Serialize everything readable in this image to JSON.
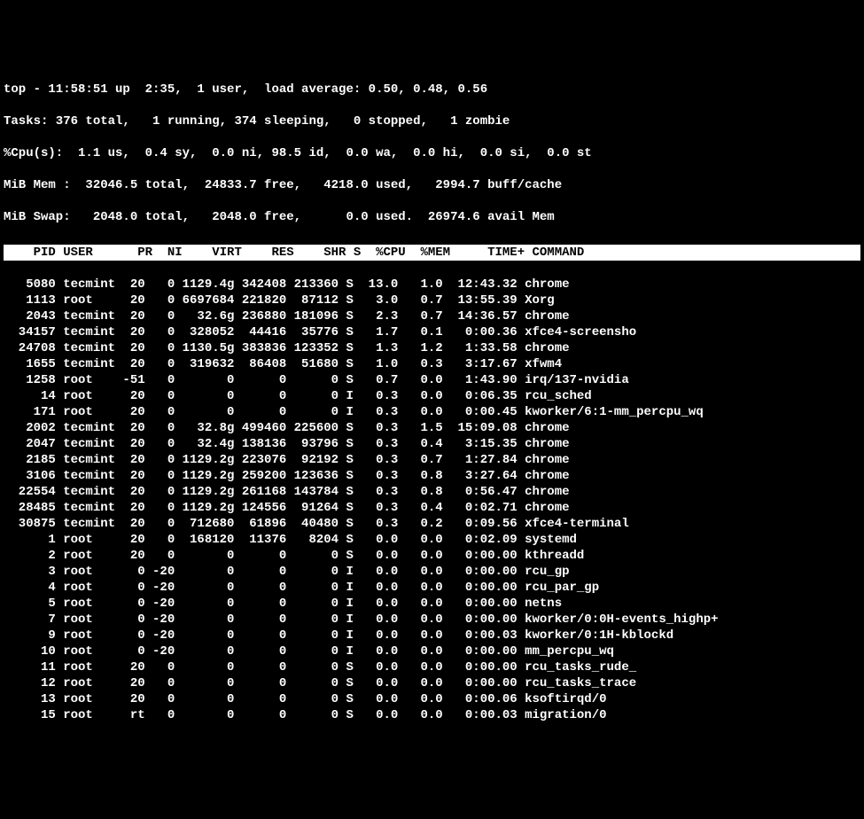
{
  "header": {
    "line1": "top - 11:58:51 up  2:35,  1 user,  load average: 0.50, 0.48, 0.56",
    "line2": "Tasks: 376 total,   1 running, 374 sleeping,   0 stopped,   1 zombie",
    "line3": "%Cpu(s):  1.1 us,  0.4 sy,  0.0 ni, 98.5 id,  0.0 wa,  0.0 hi,  0.0 si,  0.0 st",
    "line4": "MiB Mem :  32046.5 total,  24833.7 free,   4218.0 used,   2994.7 buff/cache",
    "line5": "MiB Swap:   2048.0 total,   2048.0 free,      0.0 used.  26974.6 avail Mem"
  },
  "columns": {
    "header_line": "    PID USER      PR  NI    VIRT    RES    SHR S  %CPU  %MEM     TIME+ COMMAND                          "
  },
  "processes": [
    {
      "pid": "5080",
      "user": "tecmint",
      "pr": "20",
      "ni": "0",
      "virt": "1129.4g",
      "res": "342408",
      "shr": "213360",
      "s": "S",
      "cpu": "13.0",
      "mem": "1.0",
      "time": "12:43.32",
      "cmd": "chrome"
    },
    {
      "pid": "1113",
      "user": "root",
      "pr": "20",
      "ni": "0",
      "virt": "6697684",
      "res": "221820",
      "shr": "87112",
      "s": "S",
      "cpu": "3.0",
      "mem": "0.7",
      "time": "13:55.39",
      "cmd": "Xorg"
    },
    {
      "pid": "2043",
      "user": "tecmint",
      "pr": "20",
      "ni": "0",
      "virt": "32.6g",
      "res": "236880",
      "shr": "181096",
      "s": "S",
      "cpu": "2.3",
      "mem": "0.7",
      "time": "14:36.57",
      "cmd": "chrome"
    },
    {
      "pid": "34157",
      "user": "tecmint",
      "pr": "20",
      "ni": "0",
      "virt": "328052",
      "res": "44416",
      "shr": "35776",
      "s": "S",
      "cpu": "1.7",
      "mem": "0.1",
      "time": "0:00.36",
      "cmd": "xfce4-screensho"
    },
    {
      "pid": "24708",
      "user": "tecmint",
      "pr": "20",
      "ni": "0",
      "virt": "1130.5g",
      "res": "383836",
      "shr": "123352",
      "s": "S",
      "cpu": "1.3",
      "mem": "1.2",
      "time": "1:33.58",
      "cmd": "chrome"
    },
    {
      "pid": "1655",
      "user": "tecmint",
      "pr": "20",
      "ni": "0",
      "virt": "319632",
      "res": "86408",
      "shr": "51680",
      "s": "S",
      "cpu": "1.0",
      "mem": "0.3",
      "time": "3:17.67",
      "cmd": "xfwm4"
    },
    {
      "pid": "1258",
      "user": "root",
      "pr": "-51",
      "ni": "0",
      "virt": "0",
      "res": "0",
      "shr": "0",
      "s": "S",
      "cpu": "0.7",
      "mem": "0.0",
      "time": "1:43.90",
      "cmd": "irq/137-nvidia"
    },
    {
      "pid": "14",
      "user": "root",
      "pr": "20",
      "ni": "0",
      "virt": "0",
      "res": "0",
      "shr": "0",
      "s": "I",
      "cpu": "0.3",
      "mem": "0.0",
      "time": "0:06.35",
      "cmd": "rcu_sched"
    },
    {
      "pid": "171",
      "user": "root",
      "pr": "20",
      "ni": "0",
      "virt": "0",
      "res": "0",
      "shr": "0",
      "s": "I",
      "cpu": "0.3",
      "mem": "0.0",
      "time": "0:00.45",
      "cmd": "kworker/6:1-mm_percpu_wq"
    },
    {
      "pid": "2002",
      "user": "tecmint",
      "pr": "20",
      "ni": "0",
      "virt": "32.8g",
      "res": "499460",
      "shr": "225600",
      "s": "S",
      "cpu": "0.3",
      "mem": "1.5",
      "time": "15:09.08",
      "cmd": "chrome"
    },
    {
      "pid": "2047",
      "user": "tecmint",
      "pr": "20",
      "ni": "0",
      "virt": "32.4g",
      "res": "138136",
      "shr": "93796",
      "s": "S",
      "cpu": "0.3",
      "mem": "0.4",
      "time": "3:15.35",
      "cmd": "chrome"
    },
    {
      "pid": "2185",
      "user": "tecmint",
      "pr": "20",
      "ni": "0",
      "virt": "1129.2g",
      "res": "223076",
      "shr": "92192",
      "s": "S",
      "cpu": "0.3",
      "mem": "0.7",
      "time": "1:27.84",
      "cmd": "chrome"
    },
    {
      "pid": "3106",
      "user": "tecmint",
      "pr": "20",
      "ni": "0",
      "virt": "1129.2g",
      "res": "259200",
      "shr": "123636",
      "s": "S",
      "cpu": "0.3",
      "mem": "0.8",
      "time": "3:27.64",
      "cmd": "chrome"
    },
    {
      "pid": "22554",
      "user": "tecmint",
      "pr": "20",
      "ni": "0",
      "virt": "1129.2g",
      "res": "261168",
      "shr": "143784",
      "s": "S",
      "cpu": "0.3",
      "mem": "0.8",
      "time": "0:56.47",
      "cmd": "chrome"
    },
    {
      "pid": "28485",
      "user": "tecmint",
      "pr": "20",
      "ni": "0",
      "virt": "1129.2g",
      "res": "124556",
      "shr": "91264",
      "s": "S",
      "cpu": "0.3",
      "mem": "0.4",
      "time": "0:02.71",
      "cmd": "chrome"
    },
    {
      "pid": "30875",
      "user": "tecmint",
      "pr": "20",
      "ni": "0",
      "virt": "712680",
      "res": "61896",
      "shr": "40480",
      "s": "S",
      "cpu": "0.3",
      "mem": "0.2",
      "time": "0:09.56",
      "cmd": "xfce4-terminal"
    },
    {
      "pid": "1",
      "user": "root",
      "pr": "20",
      "ni": "0",
      "virt": "168120",
      "res": "11376",
      "shr": "8204",
      "s": "S",
      "cpu": "0.0",
      "mem": "0.0",
      "time": "0:02.09",
      "cmd": "systemd"
    },
    {
      "pid": "2",
      "user": "root",
      "pr": "20",
      "ni": "0",
      "virt": "0",
      "res": "0",
      "shr": "0",
      "s": "S",
      "cpu": "0.0",
      "mem": "0.0",
      "time": "0:00.00",
      "cmd": "kthreadd"
    },
    {
      "pid": "3",
      "user": "root",
      "pr": "0",
      "ni": "-20",
      "virt": "0",
      "res": "0",
      "shr": "0",
      "s": "I",
      "cpu": "0.0",
      "mem": "0.0",
      "time": "0:00.00",
      "cmd": "rcu_gp"
    },
    {
      "pid": "4",
      "user": "root",
      "pr": "0",
      "ni": "-20",
      "virt": "0",
      "res": "0",
      "shr": "0",
      "s": "I",
      "cpu": "0.0",
      "mem": "0.0",
      "time": "0:00.00",
      "cmd": "rcu_par_gp"
    },
    {
      "pid": "5",
      "user": "root",
      "pr": "0",
      "ni": "-20",
      "virt": "0",
      "res": "0",
      "shr": "0",
      "s": "I",
      "cpu": "0.0",
      "mem": "0.0",
      "time": "0:00.00",
      "cmd": "netns"
    },
    {
      "pid": "7",
      "user": "root",
      "pr": "0",
      "ni": "-20",
      "virt": "0",
      "res": "0",
      "shr": "0",
      "s": "I",
      "cpu": "0.0",
      "mem": "0.0",
      "time": "0:00.00",
      "cmd": "kworker/0:0H-events_highp+"
    },
    {
      "pid": "9",
      "user": "root",
      "pr": "0",
      "ni": "-20",
      "virt": "0",
      "res": "0",
      "shr": "0",
      "s": "I",
      "cpu": "0.0",
      "mem": "0.0",
      "time": "0:00.03",
      "cmd": "kworker/0:1H-kblockd"
    },
    {
      "pid": "10",
      "user": "root",
      "pr": "0",
      "ni": "-20",
      "virt": "0",
      "res": "0",
      "shr": "0",
      "s": "I",
      "cpu": "0.0",
      "mem": "0.0",
      "time": "0:00.00",
      "cmd": "mm_percpu_wq"
    },
    {
      "pid": "11",
      "user": "root",
      "pr": "20",
      "ni": "0",
      "virt": "0",
      "res": "0",
      "shr": "0",
      "s": "S",
      "cpu": "0.0",
      "mem": "0.0",
      "time": "0:00.00",
      "cmd": "rcu_tasks_rude_"
    },
    {
      "pid": "12",
      "user": "root",
      "pr": "20",
      "ni": "0",
      "virt": "0",
      "res": "0",
      "shr": "0",
      "s": "S",
      "cpu": "0.0",
      "mem": "0.0",
      "time": "0:00.00",
      "cmd": "rcu_tasks_trace"
    },
    {
      "pid": "13",
      "user": "root",
      "pr": "20",
      "ni": "0",
      "virt": "0",
      "res": "0",
      "shr": "0",
      "s": "S",
      "cpu": "0.0",
      "mem": "0.0",
      "time": "0:00.06",
      "cmd": "ksoftirqd/0"
    },
    {
      "pid": "15",
      "user": "root",
      "pr": "rt",
      "ni": "0",
      "virt": "0",
      "res": "0",
      "shr": "0",
      "s": "S",
      "cpu": "0.0",
      "mem": "0.0",
      "time": "0:00.03",
      "cmd": "migration/0"
    }
  ]
}
